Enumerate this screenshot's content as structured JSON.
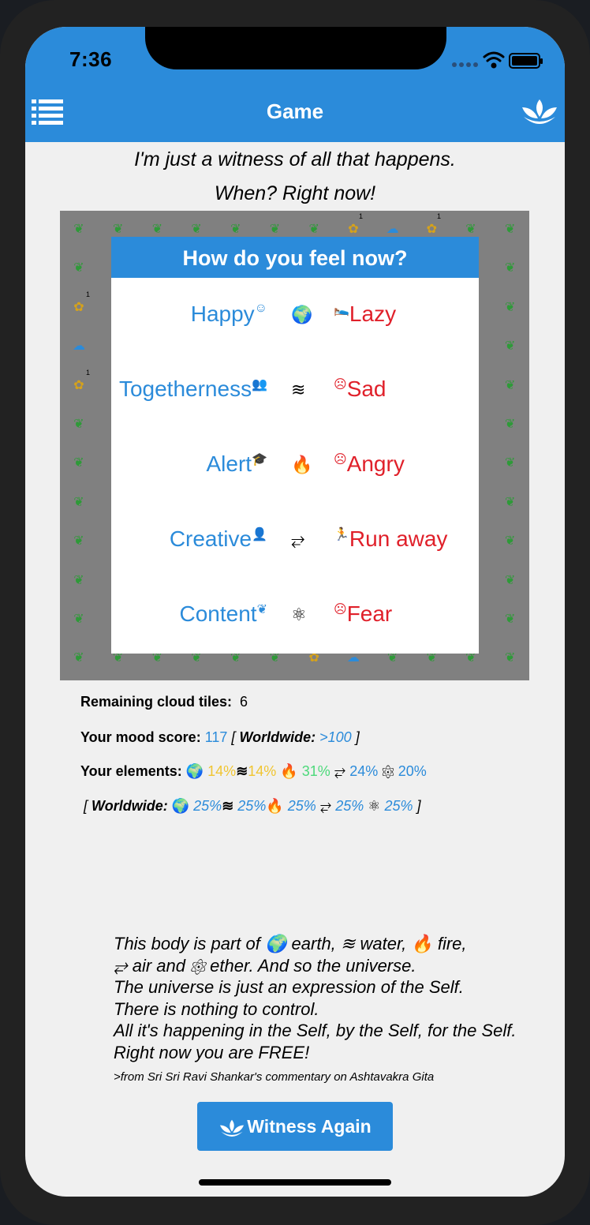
{
  "status_bar": {
    "time": "7:36"
  },
  "nav": {
    "title": "Game"
  },
  "quote_top": {
    "line1": "I'm just a witness of all that happens.",
    "line2": "When? Right now!"
  },
  "board": {
    "badge_1": "1",
    "badge_2": "1",
    "badge_3": "1",
    "badge_4": "1"
  },
  "dialog": {
    "title": "How do you feel now?",
    "rows": [
      {
        "positive": "Happy",
        "positive_icon": "☺",
        "element_icon": "earth-icon",
        "negative_icon": "🛌",
        "negative": "Lazy"
      },
      {
        "positive": "Togetherness",
        "positive_icon": "👥",
        "element_icon": "water-icon",
        "negative_icon": "☹",
        "negative": "Sad"
      },
      {
        "positive": "Alert",
        "positive_icon": "🎓",
        "element_icon": "fire-icon",
        "negative_icon": "☹",
        "negative": "Angry"
      },
      {
        "positive": "Creative",
        "positive_icon": "👤",
        "element_icon": "air-icon",
        "negative_icon": "🏃",
        "negative": "Run away"
      },
      {
        "positive": "Content",
        "positive_icon": "❦",
        "element_icon": "ether-icon",
        "negative_icon": "☹",
        "negative": "Fear"
      }
    ]
  },
  "stats": {
    "remaining_label": "Remaining cloud tiles:",
    "remaining_value": "6",
    "mood_label": "Your mood score:",
    "mood_value": "117",
    "open_bracket": "[",
    "worldwide_label": "Worldwide:",
    "worldwide_mood": ">100",
    "close_bracket": "]",
    "elements_label": "Your elements:",
    "elements": [
      "14%",
      "14%",
      "31%",
      "24%",
      "20%"
    ],
    "worldwide_elements": [
      "25%",
      "25%",
      "25%",
      "25%",
      "25%"
    ],
    "colors": {
      "yellow": "#f0c531",
      "green": "#4cd97a",
      "blue": "#2b8bda"
    }
  },
  "quote_bottom": {
    "l1a": "This body is part of",
    "l1b": "earth,",
    "l1c": "water,",
    "l1d": "fire,",
    "l2a": "air and",
    "l2b": "ether. And so the universe.",
    "l3": "The universe is just an expression of the Self.",
    "l4": "There is nothing to control.",
    "l5": "All it's happening in the Self, by the Self, for the Self.",
    "l6": "Right now you are FREE!",
    "source": ">from Sri Sri Ravi Shankar's commentary on Ashtavakra Gita"
  },
  "button": {
    "label": "Witness Again"
  },
  "accent": "#2b8bda"
}
